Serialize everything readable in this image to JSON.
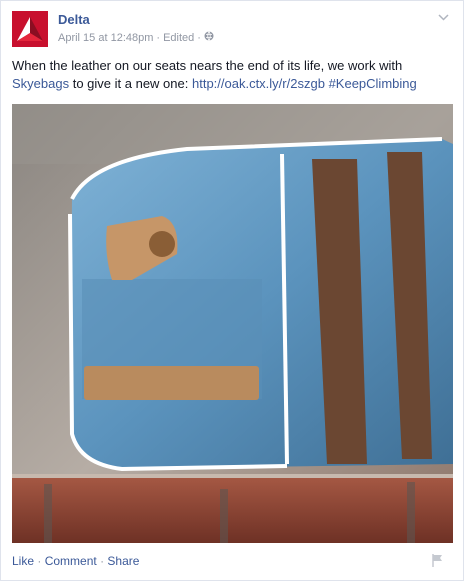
{
  "post": {
    "page_name": "Delta",
    "date": "April 15 at 12:48pm",
    "edited": "Edited",
    "text_part1": "When the leather on our seats nears the end of its life, we work with",
    "mention": "Skyebags",
    "text_part2": "to give it a new one:",
    "link": "http://oak.ctx.ly/r/2szgb",
    "hashtag": "#KeepClimbing",
    "sep": "·"
  },
  "actions": {
    "like": "Like",
    "comment": "Comment",
    "share": "Share",
    "sep": "·"
  },
  "colors": {
    "link": "#3b5998",
    "brand": "#c01933",
    "meta": "#9197a3"
  },
  "icons": [
    "delta-logo-icon",
    "globe-icon",
    "chevron-down-icon",
    "flag-icon"
  ]
}
